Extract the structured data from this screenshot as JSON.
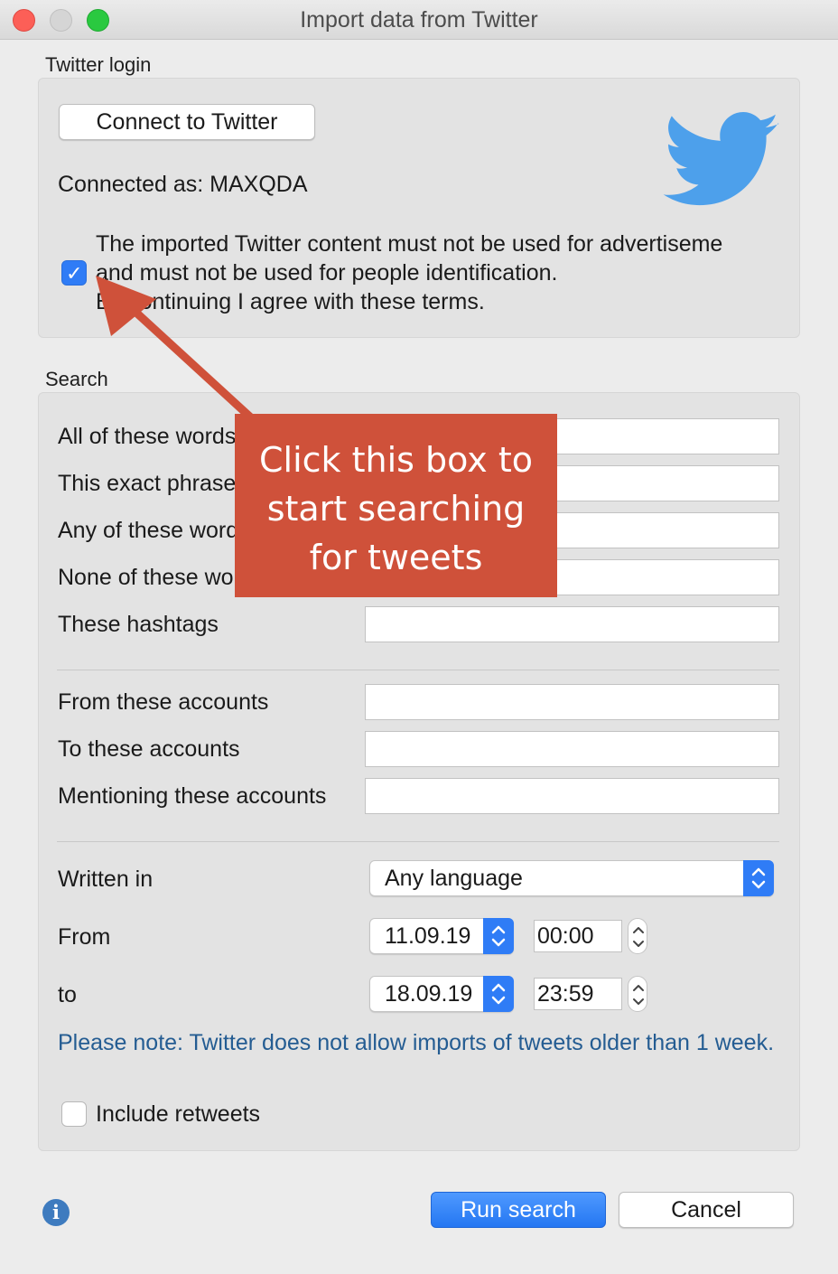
{
  "window": {
    "title": "Import data from Twitter"
  },
  "login": {
    "section_label": "Twitter login",
    "connect_button": "Connect to Twitter",
    "connected_as": "Connected as: MAXQDA",
    "terms_line1": "The imported Twitter content must not be used for advertiseme",
    "terms_line2": "and must not be used for people identification.",
    "terms_line3": "By continuing I agree with these terms.",
    "terms_checked": true
  },
  "search": {
    "section_label": "Search",
    "all_words": "All of these words",
    "exact_phrase": "This exact phrase",
    "any_words": "Any of these words",
    "none_words": "None of  these words",
    "hashtags": "These hashtags",
    "from_accounts": "From these accounts",
    "to_accounts": "To these accounts",
    "mentioning": "Mentioning these accounts",
    "written_in_label": "Written in",
    "language_value": "Any language",
    "from_label": "From",
    "from_date": "11.09.19",
    "from_time": "00:00",
    "to_label": "to",
    "to_date": "18.09.19",
    "to_time": "23:59",
    "note": "Please note: Twitter does not allow imports of tweets older than 1 week.",
    "include_retweets": "Include retweets"
  },
  "footer": {
    "run_button": "Run search",
    "cancel_button": "Cancel"
  },
  "callout": {
    "line1": "Click this box to",
    "line2": "start searching",
    "line3": "for tweets"
  },
  "colors": {
    "accent": "#2f7cf6",
    "twitter_blue": "#4da0eb",
    "callout": "#cf513a",
    "note_text": "#245c92"
  },
  "icons": [
    "twitter-bird-icon",
    "checkmark-icon",
    "chevron-updown-icon",
    "info-icon",
    "arrow-icon"
  ]
}
